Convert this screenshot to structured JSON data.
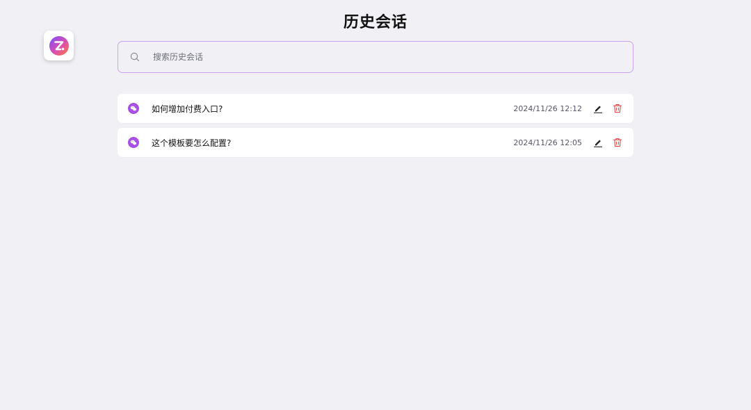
{
  "page": {
    "title": "历史会话"
  },
  "app": {
    "logo_icon": "app-logo-icon",
    "accent": "#a94fe6"
  },
  "search": {
    "placeholder": "搜索历史会话",
    "value": "",
    "icon": "search-icon",
    "border_color": "#c9a2ef"
  },
  "sessions": [
    {
      "title": "如何增加付费入口?",
      "time": "2024/11/26 12:12",
      "icon": "chat-bubble-icon"
    },
    {
      "title": "这个模板要怎么配置?",
      "time": "2024/11/26 12:05",
      "icon": "chat-bubble-icon"
    }
  ],
  "actions": {
    "edit_icon": "pencil-icon",
    "delete_icon": "trash-icon",
    "delete_color": "#e04848"
  }
}
